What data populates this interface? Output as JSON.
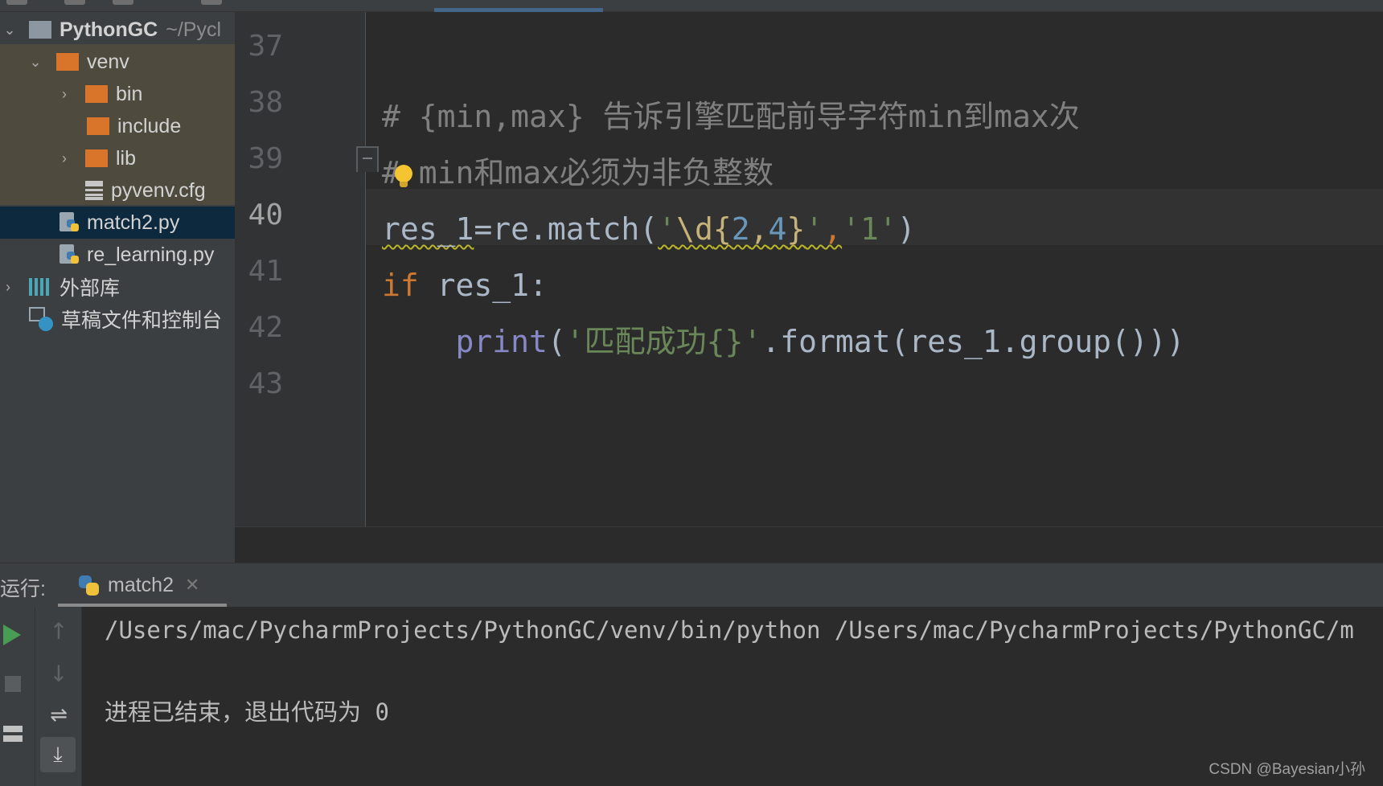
{
  "project_tree": {
    "root": {
      "name": "PythonGC",
      "path": "~/Pycl"
    },
    "items": [
      {
        "label": "venv"
      },
      {
        "label": "bin"
      },
      {
        "label": "include"
      },
      {
        "label": "lib"
      },
      {
        "label": "pyvenv.cfg"
      },
      {
        "label": "match2.py"
      },
      {
        "label": "re_learning.py"
      },
      {
        "label": "外部库"
      },
      {
        "label": "草稿文件和控制台"
      }
    ]
  },
  "editor": {
    "current_line": "40",
    "line_numbers": [
      "37",
      "38",
      "39",
      "40",
      "41",
      "42",
      "43"
    ],
    "code": {
      "l38": "# {min,max} 告诉引擎匹配前导字符min到max次",
      "l39_hash": "#",
      "l39_rest": " min和max必须为非负整数",
      "l40": {
        "a": "res_1",
        "b": "=re.match(",
        "q1": "'",
        "re_d": "\\d",
        "re_ob": "{",
        "re_2": "2",
        "re_comma": ",",
        "re_4": "4",
        "re_cb": "}",
        "q2": "'",
        "comma": ",",
        "s2": "'1'",
        "close": ")"
      },
      "l41": {
        "kw": "if",
        "rest": " res_1:"
      },
      "l42": {
        "fn": "print",
        "open": "(",
        "str": "'匹配成功{}'",
        "rest": ".format(res_1.group()))"
      }
    }
  },
  "run_panel": {
    "label": "运行:",
    "tab": "match2",
    "close_glyph": "✕",
    "console": [
      "/Users/mac/PycharmProjects/PythonGC/venv/bin/python /Users/mac/PycharmProjects/PythonGC/m",
      "进程已结束，退出代码为 0"
    ],
    "icons": [
      "run-icon",
      "stop-icon",
      "layout-icon",
      "up-arrow-icon",
      "down-arrow-icon",
      "soft-wrap-icon",
      "scroll-to-end-icon"
    ]
  },
  "watermark": "CSDN @Bayesian小孙"
}
